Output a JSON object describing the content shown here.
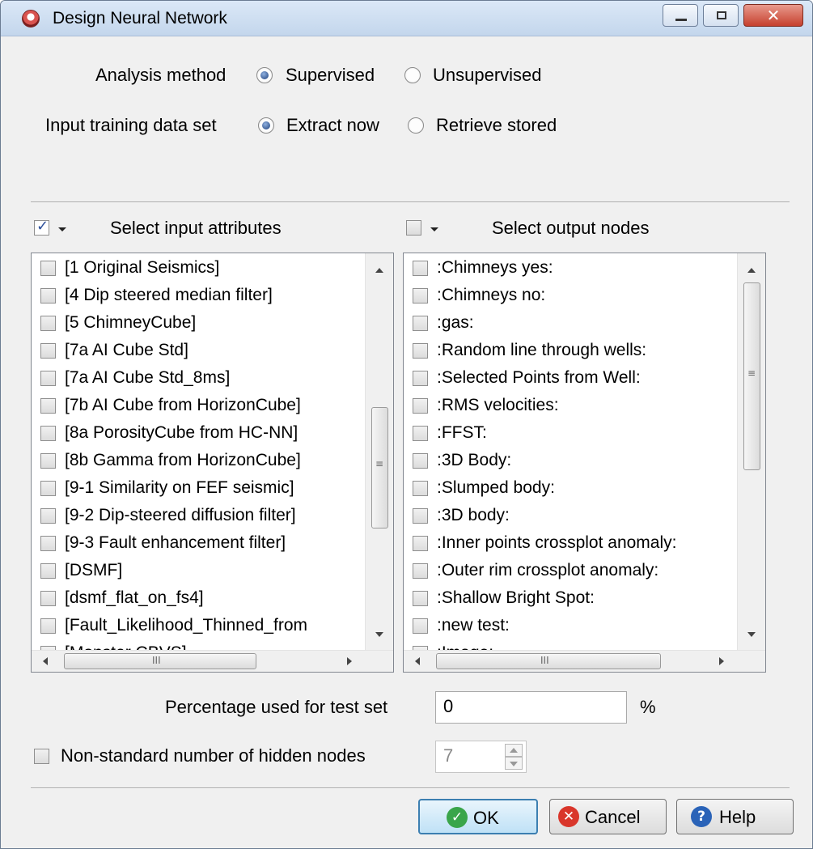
{
  "window": {
    "title": "Design Neural Network"
  },
  "analysis": {
    "label": "Analysis method",
    "options": [
      "Supervised",
      "Unsupervised"
    ],
    "selected": "Supervised"
  },
  "training": {
    "label": "Input training data set",
    "options": [
      "Extract now",
      "Retrieve stored"
    ],
    "selected": "Extract now"
  },
  "input_attributes": {
    "header": "Select input attributes",
    "select_all_checked": true,
    "items": [
      "[1 Original Seismics]",
      "[4 Dip steered median filter]",
      "[5 ChimneyCube]",
      "[7a AI Cube Std]",
      "[7a AI Cube Std_8ms]",
      "[7b AI Cube from HorizonCube]",
      "[8a PorosityCube from HC-NN]",
      "[8b Gamma from HorizonCube]",
      "[9-1 Similarity on FEF seismic]",
      "[9-2 Dip-steered diffusion filter]",
      "[9-3 Fault enhancement filter]",
      "[DSMF]",
      "[dsmf_flat_on_fs4]",
      "[Fault_Likelihood_Thinned_from",
      "[Monster CBVS]"
    ]
  },
  "output_nodes": {
    "header": "Select output nodes",
    "select_all_checked": false,
    "items": [
      ":Chimneys yes:",
      ":Chimneys no:",
      ":gas:",
      ":Random line through wells:",
      ":Selected Points from Well:",
      ":RMS velocities:",
      ":FFST:",
      ":3D Body:",
      ":Slumped body:",
      ":3D body:",
      ":Inner points crossplot anomaly:",
      ":Outer rim crossplot anomaly:",
      ":Shallow Bright Spot:",
      ":new test:",
      ":Image:"
    ]
  },
  "test_set": {
    "label": "Percentage used for test set",
    "value": "0",
    "unit": "%"
  },
  "hidden_nodes": {
    "label": "Non-standard number of hidden nodes",
    "checked": false,
    "value": "7"
  },
  "buttons": {
    "ok": "OK",
    "cancel": "Cancel",
    "help": "Help"
  },
  "scrollbar_grip": {
    "vertical": "≡",
    "horizontal": "III"
  },
  "icons": {
    "app": "neural-network-app-icon",
    "ok": "check-circle-icon",
    "cancel": "x-circle-icon",
    "help": "question-circle-icon"
  },
  "colors": {
    "ok_icon": "#3aa54a",
    "cancel_icon": "#d9362b",
    "help_icon": "#2a63b8",
    "title_bar": "#c9daee"
  }
}
